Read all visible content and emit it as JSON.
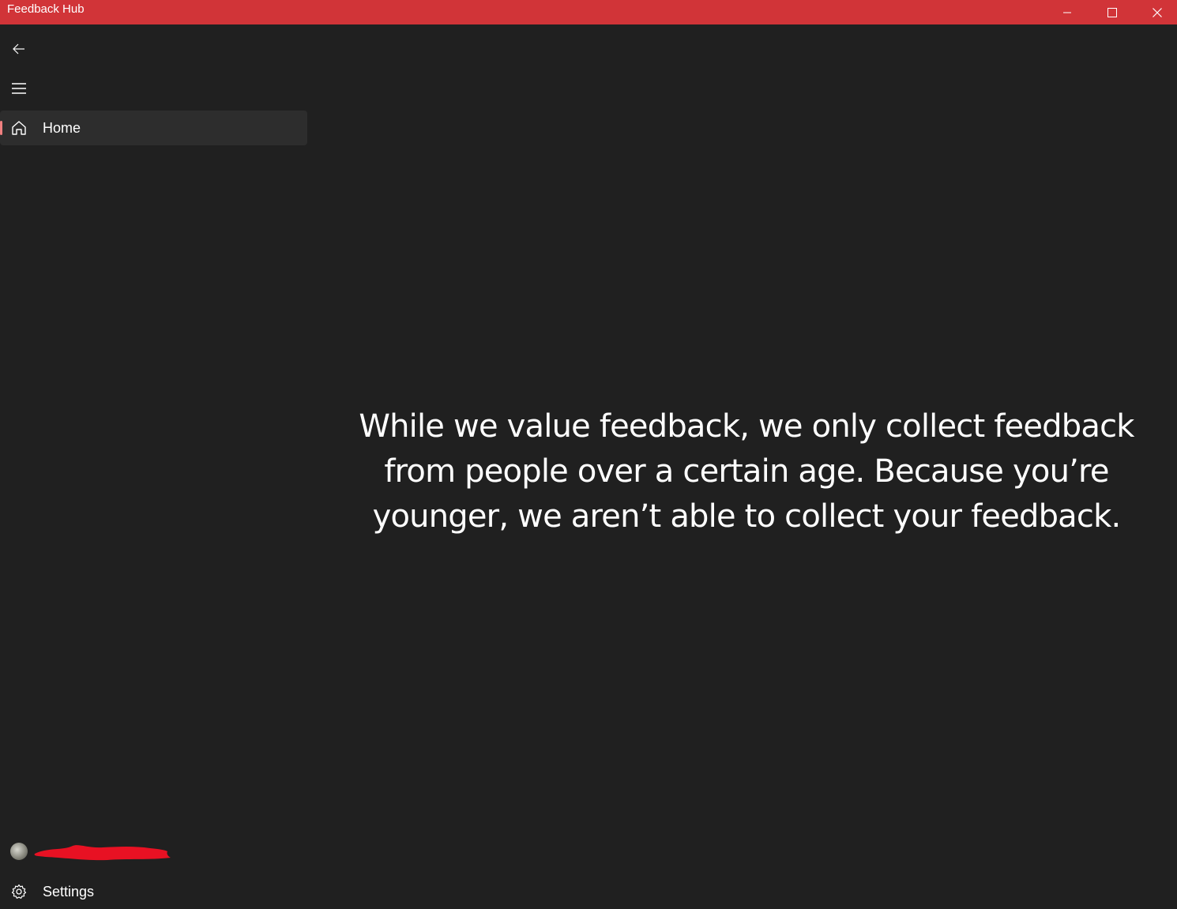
{
  "window": {
    "title": "Feedback Hub",
    "titlebar_color": "#d13438",
    "controls": [
      "minimize-icon",
      "maximize-icon",
      "close-icon"
    ]
  },
  "sidebar": {
    "back_icon": "arrow-left-icon",
    "menu_icon": "hamburger-icon",
    "items": [
      {
        "label": "Home",
        "icon": "home-icon",
        "selected": true
      }
    ],
    "footer": {
      "account": {
        "icon": "avatar",
        "name": ""
      },
      "settings": {
        "label": "Settings",
        "icon": "gear-icon"
      }
    },
    "accent_color": "#f08080"
  },
  "main": {
    "message": "While we value feedback, we only collect feedback from people over a certain age. Because you’re younger, we aren’t able to collect your feedback."
  },
  "theme": {
    "background": "#202020",
    "selected_background": "#2d2d2d"
  }
}
